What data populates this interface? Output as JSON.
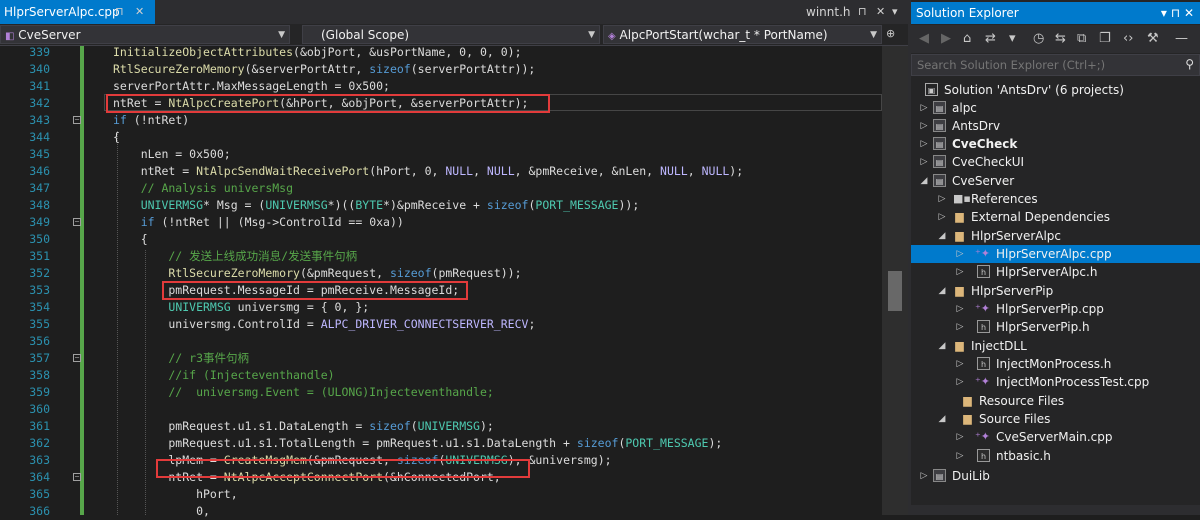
{
  "editor": {
    "tab_active": "HlprServerAlpc.cpp",
    "tab_right": "winnt.h",
    "nav_project": "CveServer",
    "nav_scope": "(Global Scope)",
    "nav_function": "AlpcPortStart(wchar_t * PortName)",
    "lines": [
      {
        "n": "339",
        "t": "InitializeObjectAttributes(&objPort, &usPortName, 0, 0, 0);"
      },
      {
        "n": "340",
        "t": "RtlSecureZeroMemory(&serverPortAttr, sizeof(serverPortAttr));"
      },
      {
        "n": "341",
        "t": "serverPortAttr.MaxMessageLength = 0x500;"
      },
      {
        "n": "342",
        "t": "ntRet = NtAlpcCreatePort(&hPort, &objPort, &serverPortAttr);"
      },
      {
        "n": "343",
        "t": "if (!ntRet)"
      },
      {
        "n": "344",
        "t": "{"
      },
      {
        "n": "345",
        "t": "    nLen = 0x500;"
      },
      {
        "n": "346",
        "t": "    ntRet = NtAlpcSendWaitReceivePort(hPort, 0, NULL, NULL, &pmReceive, &nLen, NULL, NULL);"
      },
      {
        "n": "347",
        "t": "    // Analysis universMsg"
      },
      {
        "n": "348",
        "t": "    UNIVERMSG* Msg = (UNIVERMSG*)((BYTE*)&pmReceive + sizeof(PORT_MESSAGE));"
      },
      {
        "n": "349",
        "t": "    if (!ntRet || (Msg->ControlId == 0xa))"
      },
      {
        "n": "350",
        "t": "    {"
      },
      {
        "n": "351",
        "t": "        // 发送上线成功消息/发送事件句柄"
      },
      {
        "n": "352",
        "t": "        RtlSecureZeroMemory(&pmRequest, sizeof(pmRequest));"
      },
      {
        "n": "353",
        "t": "        pmRequest.MessageId = pmReceive.MessageId;"
      },
      {
        "n": "354",
        "t": "        UNIVERMSG universmg = { 0, };"
      },
      {
        "n": "355",
        "t": "        universmg.ControlId = ALPC_DRIVER_CONNECTSERVER_RECV;"
      },
      {
        "n": "356",
        "t": ""
      },
      {
        "n": "357",
        "t": "        // r3事件句柄"
      },
      {
        "n": "358",
        "t": "        //if (Injecteventhandle)"
      },
      {
        "n": "359",
        "t": "        //  universmg.Event = (ULONG)Injecteventhandle;"
      },
      {
        "n": "360",
        "t": ""
      },
      {
        "n": "361",
        "t": "        pmRequest.u1.s1.DataLength = sizeof(UNIVERMSG);"
      },
      {
        "n": "362",
        "t": "        pmRequest.u1.s1.TotalLength = pmRequest.u1.s1.DataLength + sizeof(PORT_MESSAGE);"
      },
      {
        "n": "363",
        "t": "        lpMem = CreateMsgMem(&pmRequest, sizeof(UNIVERMSG), &universmg);"
      },
      {
        "n": "364",
        "t": "        ntRet = NtAlpcAcceptConnectPort(&hConnectedPort,"
      },
      {
        "n": "365",
        "t": "            hPort,"
      },
      {
        "n": "366",
        "t": "            0,"
      }
    ]
  },
  "solution_explorer": {
    "title": "Solution Explorer",
    "search_placeholder": "Search Solution Explorer (Ctrl+;)",
    "items": [
      {
        "label": "Solution 'AntsDrv' (6 projects)",
        "icon": "solution-icon"
      },
      {
        "label": "alpc",
        "icon": "project-icon"
      },
      {
        "label": "AntsDrv",
        "icon": "project-icon"
      },
      {
        "label": "CveCheck",
        "icon": "project-icon"
      },
      {
        "label": "CveCheckUI",
        "icon": "project-icon"
      },
      {
        "label": "CveServer",
        "icon": "project-icon"
      },
      {
        "label": "References",
        "icon": "references-icon"
      },
      {
        "label": "External Dependencies",
        "icon": "external-dependencies-icon"
      },
      {
        "label": "HlprServerAlpc",
        "icon": "folder-icon"
      },
      {
        "label": "HlprServerAlpc.cpp",
        "icon": "cpp-file-icon"
      },
      {
        "label": "HlprServerAlpc.h",
        "icon": "header-file-icon"
      },
      {
        "label": "HlprServerPip",
        "icon": "folder-icon"
      },
      {
        "label": "HlprServerPip.cpp",
        "icon": "cpp-file-icon"
      },
      {
        "label": "HlprServerPip.h",
        "icon": "header-file-icon"
      },
      {
        "label": "InjectDLL",
        "icon": "folder-icon"
      },
      {
        "label": "InjectMonProcess.h",
        "icon": "header-file-icon"
      },
      {
        "label": "InjectMonProcessTest.cpp",
        "icon": "cpp-file-icon"
      },
      {
        "label": "Resource Files",
        "icon": "folder-icon"
      },
      {
        "label": "Source Files",
        "icon": "folder-icon"
      },
      {
        "label": "CveServerMain.cpp",
        "icon": "cpp-file-icon"
      },
      {
        "label": "ntbasic.h",
        "icon": "header-file-icon"
      },
      {
        "label": "DuiLib",
        "icon": "project-icon"
      }
    ]
  },
  "colors": {
    "accent": "#007acc",
    "highlight_box": "#e23b3b",
    "keyword": "#569cd6",
    "comment": "#57a64a"
  }
}
